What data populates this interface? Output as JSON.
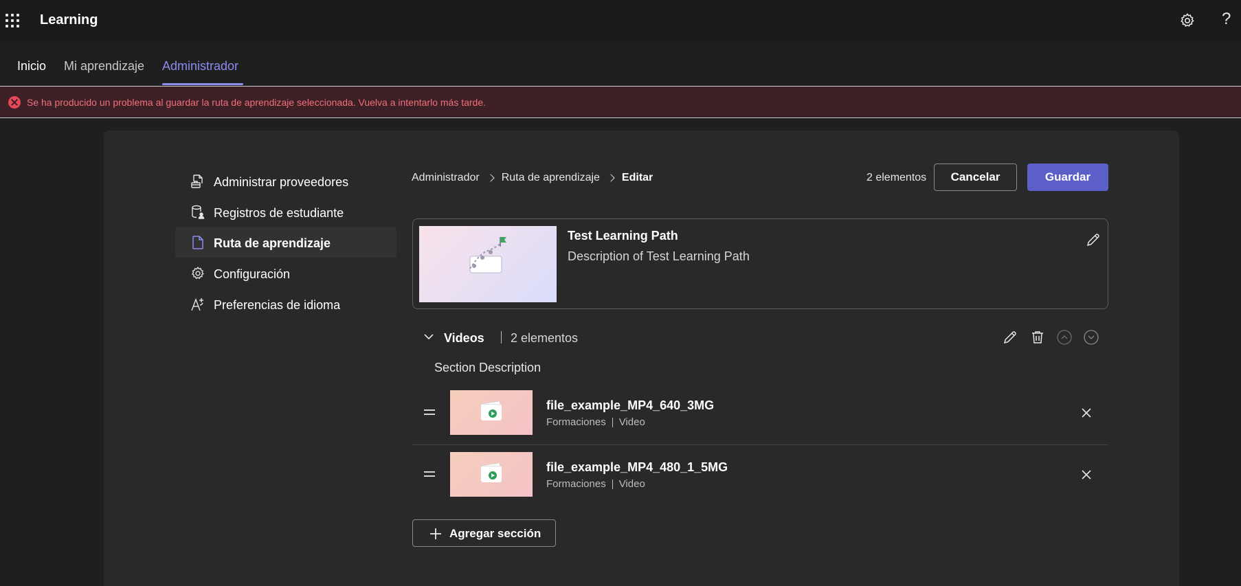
{
  "app": {
    "title": "Learning"
  },
  "tabs": [
    {
      "label": "Inicio"
    },
    {
      "label": "Mi aprendizaje"
    },
    {
      "label": "Administrador",
      "active": true
    }
  ],
  "error": {
    "message": "Se ha producido un problema al guardar la ruta de aprendizaje seleccionada. Vuelva a intentarlo más tarde."
  },
  "sidebar": {
    "items": [
      {
        "label": "Administrar proveedores",
        "icon": "providers-icon"
      },
      {
        "label": "Registros de estudiante",
        "icon": "database-user-icon"
      },
      {
        "label": "Ruta de aprendizaje",
        "icon": "document-icon",
        "active": true
      },
      {
        "label": "Configuración",
        "icon": "gear-icon"
      },
      {
        "label": "Preferencias de idioma",
        "icon": "language-icon"
      }
    ]
  },
  "breadcrumb": {
    "items": [
      "Administrador",
      "Ruta de aprendizaje"
    ],
    "current": "Editar"
  },
  "toolbar": {
    "count": "2 elementos",
    "cancel_label": "Cancelar",
    "save_label": "Guardar"
  },
  "learning_path": {
    "title": "Test Learning Path",
    "description": "Description of Test Learning Path"
  },
  "section": {
    "name": "Videos",
    "count": "2 elementos",
    "description": "Section Description",
    "items": [
      {
        "title": "file_example_MP4_640_3MG",
        "source": "Formaciones",
        "type": "Video"
      },
      {
        "title": "file_example_MP4_480_1_5MG",
        "source": "Formaciones",
        "type": "Video"
      }
    ]
  },
  "add_section_label": "Agregar sección",
  "colors": {
    "accent": "#5b5fc7",
    "accent_text": "#8b8cf2",
    "error_bg": "#3d1f26",
    "error_text": "#f1707b",
    "error_icon": "#e74856"
  }
}
